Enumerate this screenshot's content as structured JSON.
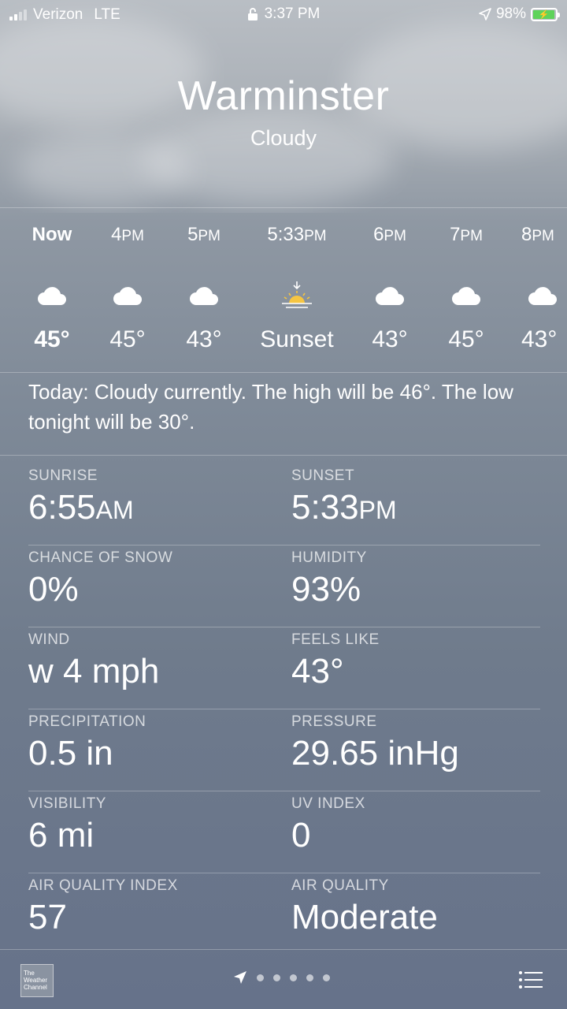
{
  "status_bar": {
    "carrier": "Verizon",
    "network": "LTE",
    "time": "3:37 PM",
    "battery": "98%"
  },
  "location": {
    "city": "Warminster",
    "condition": "Cloudy"
  },
  "hourly": [
    {
      "time": "Now",
      "suffix": "",
      "icon": "cloud-icon",
      "temp": "45°"
    },
    {
      "time": "4",
      "suffix": "PM",
      "icon": "cloud-icon",
      "temp": "45°"
    },
    {
      "time": "5",
      "suffix": "PM",
      "icon": "cloud-icon",
      "temp": "43°"
    },
    {
      "time": "5:33",
      "suffix": "PM",
      "icon": "sunset-icon",
      "temp": "Sunset"
    },
    {
      "time": "6",
      "suffix": "PM",
      "icon": "cloud-icon",
      "temp": "43°"
    },
    {
      "time": "7",
      "suffix": "PM",
      "icon": "cloud-icon",
      "temp": "45°"
    },
    {
      "time": "8",
      "suffix": "PM",
      "icon": "cloud-icon",
      "temp": "43°"
    }
  ],
  "summary": "Today: Cloudy currently. The high will be 46°. The low tonight will be 30°.",
  "details": [
    {
      "left_label": "SUNRISE",
      "left_value": "6:55",
      "left_suffix": "AM",
      "right_label": "SUNSET",
      "right_value": "5:33",
      "right_suffix": "PM"
    },
    {
      "left_label": "CHANCE OF SNOW",
      "left_value": "0%",
      "left_suffix": "",
      "right_label": "HUMIDITY",
      "right_value": "93%",
      "right_suffix": ""
    },
    {
      "left_label": "WIND",
      "left_value": "w 4 mph",
      "left_suffix": "",
      "right_label": "FEELS LIKE",
      "right_value": "43°",
      "right_suffix": ""
    },
    {
      "left_label": "PRECIPITATION",
      "left_value": "0.5 in",
      "left_suffix": "",
      "right_label": "PRESSURE",
      "right_value": "29.65 inHg",
      "right_suffix": ""
    },
    {
      "left_label": "VISIBILITY",
      "left_value": "6 mi",
      "left_suffix": "",
      "right_label": "UV INDEX",
      "right_value": "0",
      "right_suffix": ""
    },
    {
      "left_label": "AIR QUALITY INDEX",
      "left_value": "57",
      "left_suffix": "",
      "right_label": "AIR QUALITY",
      "right_value": "Moderate",
      "right_suffix": ""
    }
  ],
  "bottom_bar": {
    "logo_text": "The Weather Channel",
    "page_count": 5
  },
  "colors": {
    "battery_fill": "#5fd35b",
    "sun": "#f5c542"
  }
}
